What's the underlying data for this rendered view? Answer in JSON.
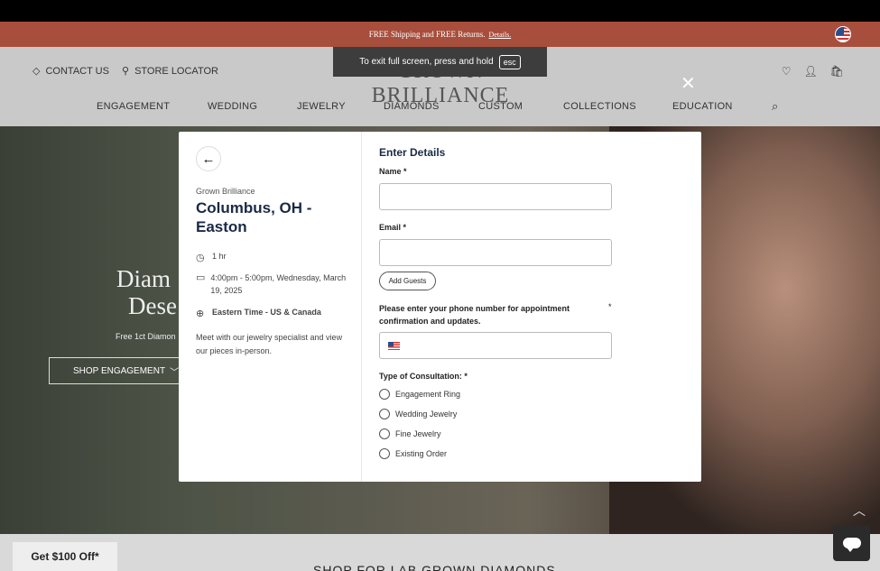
{
  "promo": {
    "text": "FREE Shipping and FREE Returns.",
    "link": "Details."
  },
  "header": {
    "contact": "CONTACT US",
    "store": "STORE LOCATOR",
    "logo": "GROWN BRILLIANCE",
    "nav": [
      "ENGAGEMENT",
      "WEDDING",
      "JEWELRY",
      "DIAMONDS",
      "CUSTOM",
      "COLLECTIONS",
      "EDUCATION"
    ]
  },
  "fullscreen": {
    "text": "To exit full screen, press and hold",
    "key": "esc"
  },
  "hero": {
    "title_line1": "Diam",
    "title_line2": "Dese",
    "subtitle": "Free 1ct Diamon",
    "button": "SHOP ENGAGEMENT"
  },
  "modal": {
    "org": "Grown Brilliance",
    "location": "Columbus, OH - Easton",
    "duration": "1 hr",
    "datetime": "4:00pm - 5:00pm, Wednesday, March 19, 2025",
    "timezone": "Eastern Time - US & Canada",
    "description": "Meet with our jewelry specialist and view our pieces in-person.",
    "form_title": "Enter Details",
    "name_label": "Name *",
    "email_label": "Email *",
    "guests_button": "Add Guests",
    "phone_label": "Please enter your phone number for appointment confirmation and updates.",
    "required_star": "*",
    "consultation_label": "Type of Consultation: *",
    "options": [
      "Engagement Ring",
      "Wedding Jewelry",
      "Fine Jewelry",
      "Existing Order"
    ]
  },
  "bottom": {
    "heading": "SHOP FOR LAB GROWN DIAMONDS",
    "promo_button": "Get $100 Off*"
  },
  "colors": {
    "promo_bg": "#a84e3c",
    "title": "#1a2a44"
  }
}
